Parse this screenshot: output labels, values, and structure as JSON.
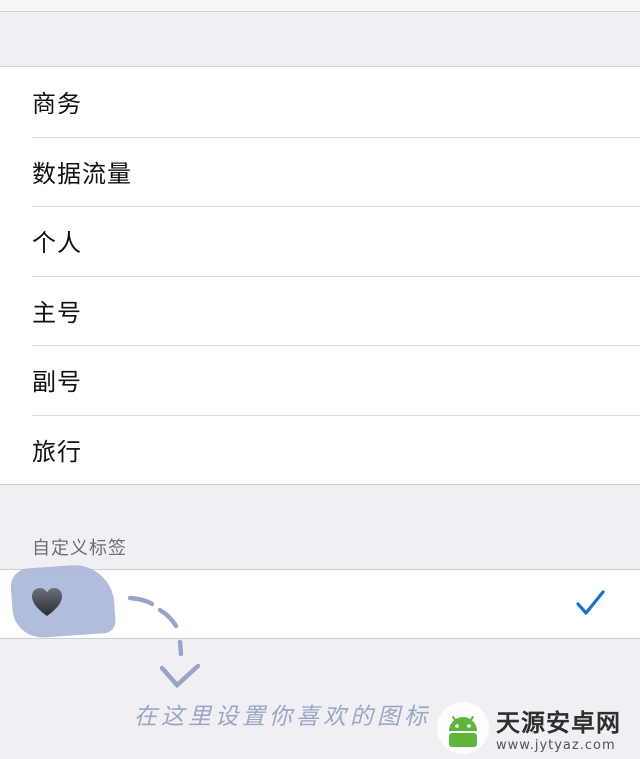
{
  "labels_list": {
    "items": [
      {
        "label": "商务"
      },
      {
        "label": "数据流量"
      },
      {
        "label": "个人"
      },
      {
        "label": "主号"
      },
      {
        "label": "副号"
      },
      {
        "label": "旅行"
      }
    ]
  },
  "custom_section": {
    "header": "自定义标签",
    "selected_icon": "black-heart-icon",
    "checkmark_icon": "checkmark-icon"
  },
  "annotation": {
    "text": "在这里设置你喜欢的图标"
  },
  "watermark": {
    "title": "天源安卓网",
    "url": "www.jytyaz.com"
  },
  "colors": {
    "background": "#efeff4",
    "accent_check": "#1a73c8",
    "annotation_ink": "#9aa6c4"
  }
}
